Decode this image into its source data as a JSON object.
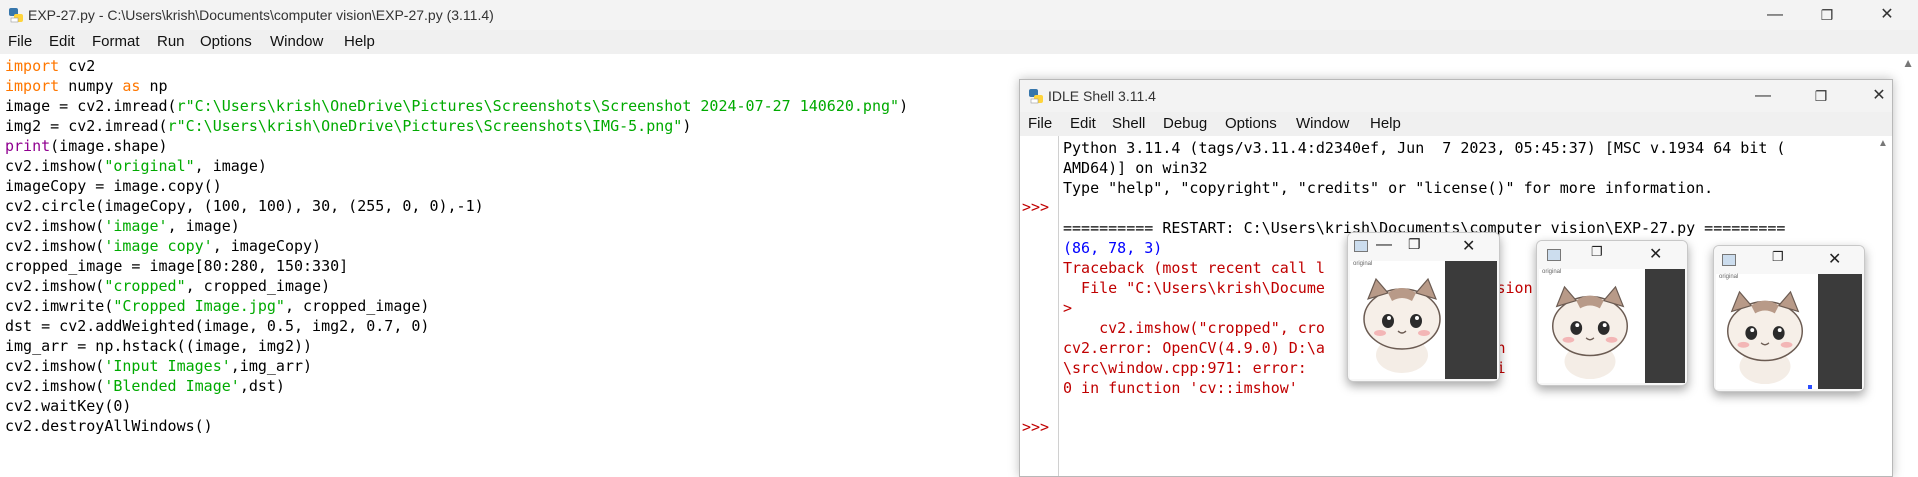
{
  "editor_window": {
    "title": "EXP-27.py - C:\\Users\\krish\\Documents\\computer vision\\EXP-27.py (3.11.4)",
    "controls": {
      "minimize": "—",
      "restore": "❐",
      "close": "✕"
    }
  },
  "menu": {
    "items": [
      "File",
      "Edit",
      "Format",
      "Run",
      "Options",
      "Window",
      "Help"
    ]
  },
  "code_lines": [
    [
      {
        "t": "import",
        "c": "kw"
      },
      {
        "t": " cv2",
        "c": ""
      }
    ],
    [
      {
        "t": "import",
        "c": "kw"
      },
      {
        "t": " numpy ",
        "c": ""
      },
      {
        "t": "as",
        "c": "kw"
      },
      {
        "t": " np",
        "c": ""
      }
    ],
    [
      {
        "t": "image = cv2.imread(",
        "c": ""
      },
      {
        "t": "r\"C:\\Users\\krish\\OneDrive\\Pictures\\Screenshots\\Screenshot 2024-07-27 140620.png\"",
        "c": "str"
      },
      {
        "t": ")",
        "c": ""
      }
    ],
    [
      {
        "t": "img2 = cv2.imread(",
        "c": ""
      },
      {
        "t": "r\"C:\\Users\\krish\\OneDrive\\Pictures\\Screenshots\\IMG-5.png\"",
        "c": "str"
      },
      {
        "t": ")",
        "c": ""
      }
    ],
    [
      {
        "t": "print",
        "c": "bi"
      },
      {
        "t": "(image.shape)",
        "c": ""
      }
    ],
    [
      {
        "t": "cv2.imshow(",
        "c": ""
      },
      {
        "t": "\"original\"",
        "c": "str"
      },
      {
        "t": ", image)",
        "c": ""
      }
    ],
    [
      {
        "t": "imageCopy = image.copy()",
        "c": ""
      }
    ],
    [
      {
        "t": "cv2.circle(imageCopy, (100, 100), 30, (255, 0, 0),-1)",
        "c": ""
      }
    ],
    [
      {
        "t": "cv2.imshow(",
        "c": ""
      },
      {
        "t": "'image'",
        "c": "str"
      },
      {
        "t": ", image)",
        "c": ""
      }
    ],
    [
      {
        "t": "cv2.imshow(",
        "c": ""
      },
      {
        "t": "'image copy'",
        "c": "str"
      },
      {
        "t": ", imageCopy)",
        "c": ""
      }
    ],
    [
      {
        "t": "cropped_image = image[80:280, 150:330]",
        "c": ""
      }
    ],
    [
      {
        "t": "cv2.imshow(",
        "c": ""
      },
      {
        "t": "\"cropped\"",
        "c": "str"
      },
      {
        "t": ", cropped_image)",
        "c": ""
      }
    ],
    [
      {
        "t": "cv2.imwrite(",
        "c": ""
      },
      {
        "t": "\"Cropped Image.jpg\"",
        "c": "str"
      },
      {
        "t": ", cropped_image)",
        "c": ""
      }
    ],
    [
      {
        "t": "dst = cv2.addWeighted(image, 0.5, img2, 0.7, 0)",
        "c": ""
      }
    ],
    [
      {
        "t": "img_arr = np.hstack((image, img2))",
        "c": ""
      }
    ],
    [
      {
        "t": "cv2.imshow(",
        "c": ""
      },
      {
        "t": "'Input Images'",
        "c": "str"
      },
      {
        "t": ",img_arr)",
        "c": ""
      }
    ],
    [
      {
        "t": "cv2.imshow(",
        "c": ""
      },
      {
        "t": "'Blended Image'",
        "c": "str"
      },
      {
        "t": ",dst)",
        "c": ""
      }
    ],
    [
      {
        "t": "cv2.waitKey(0)",
        "c": ""
      }
    ],
    [
      {
        "t": "cv2.destroyAllWindows()",
        "c": ""
      }
    ]
  ],
  "shell_window": {
    "title": "IDLE Shell 3.11.4",
    "menu": [
      "File",
      "Edit",
      "Shell",
      "Debug",
      "Options",
      "Window",
      "Help"
    ],
    "prompts": [
      ">>>",
      ">>>"
    ],
    "lines": [
      {
        "t": "Python 3.11.4 (tags/v3.11.4:d2340ef, Jun  7 2023, 05:45:37) [MSC v.1934 64 bit (",
        "c": "black"
      },
      {
        "t": "AMD64)] on win32",
        "c": "black"
      },
      {
        "t": "Type \"help\", \"copyright\", \"credits\" or \"license()\" for more information.",
        "c": "black"
      },
      {
        "t": "",
        "c": "black"
      },
      {
        "t": "========== RESTART: C:\\Users\\krish\\Documents\\computer vision\\EXP-27.py =========",
        "c": "black"
      },
      {
        "t": "(86, 78, 3)",
        "c": "blue"
      },
      {
        "t": "Traceback (most recent call l",
        "c": "red"
      },
      {
        "t": "  File \"C:\\Users\\krish\\Docume                  ision                    ine",
        "c": "red"
      },
      {
        "t": ">",
        "c": "red"
      },
      {
        "t": "    cv2.imshow(\"cropped\", cro",
        "c": "red"
      },
      {
        "t": "cv2.error: OpenCV(4.9.0) D:\\a               \\open                 cv\\",
        "c": "red"
      },
      {
        "t": "\\src\\window.cpp:971: error:                   fai                 >0",
        "c": "red"
      },
      {
        "t": "0 in function 'cv::imshow'",
        "c": "red"
      }
    ]
  },
  "cv_windows": [
    {
      "label": "original"
    },
    {
      "label": "original"
    },
    {
      "label": "original"
    }
  ],
  "colors": {
    "keyword": "#ff7700",
    "builtin": "#900090",
    "string": "#00aa00",
    "error": "#c00000",
    "output": "#0000ff"
  }
}
